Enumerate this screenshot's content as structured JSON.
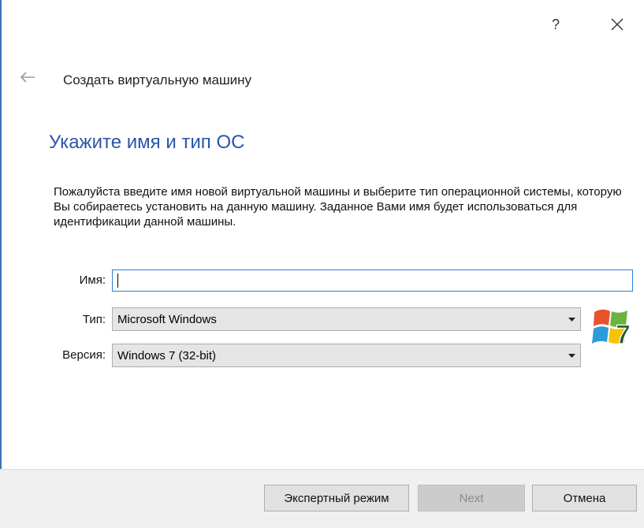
{
  "window": {
    "help_label": "?",
    "wizard_title": "Создать виртуальную машину"
  },
  "page": {
    "heading": "Укажите имя и тип ОС",
    "description": "Пожалуйста введите имя новой виртуальной машины и выберите тип операционной системы, которую Вы собираетесь установить на данную машину. Заданное Вами имя будет использоваться для идентификации данной машины."
  },
  "form": {
    "name_label": "Имя:",
    "name_value": "",
    "type_label": "Тип:",
    "type_value": "Microsoft Windows",
    "version_label": "Версия:",
    "version_value": "Windows 7 (32-bit)",
    "os_logo_text": "7"
  },
  "buttons": {
    "expert": "Экспертный режим",
    "next": "Next",
    "cancel": "Отмена"
  },
  "colors": {
    "accent": "#2b55a8",
    "input_focus": "#2c7fd2",
    "disabled_text": "#8a8a8a"
  }
}
